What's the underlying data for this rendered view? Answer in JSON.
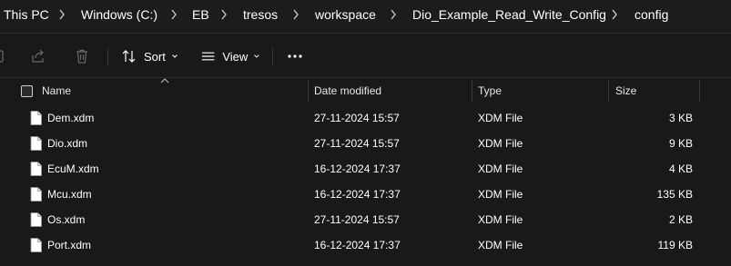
{
  "breadcrumb": {
    "items": [
      "This PC",
      "Windows (C:)",
      "EB",
      "tresos",
      "workspace",
      "Dio_Example_Read_Write_Config",
      "config"
    ]
  },
  "toolbar": {
    "sort_label": "Sort",
    "view_label": "View"
  },
  "columns": {
    "name": "Name",
    "date_modified": "Date modified",
    "type": "Type",
    "size": "Size"
  },
  "files": [
    {
      "name": "Dem.xdm",
      "date": "27-11-2024 15:57",
      "type": "XDM File",
      "size": "3 KB"
    },
    {
      "name": "Dio.xdm",
      "date": "27-11-2024 15:57",
      "type": "XDM File",
      "size": "9 KB"
    },
    {
      "name": "EcuM.xdm",
      "date": "16-12-2024 17:37",
      "type": "XDM File",
      "size": "4 KB"
    },
    {
      "name": "Mcu.xdm",
      "date": "16-12-2024 17:37",
      "type": "XDM File",
      "size": "135 KB"
    },
    {
      "name": "Os.xdm",
      "date": "27-11-2024 15:57",
      "type": "XDM File",
      "size": "2 KB"
    },
    {
      "name": "Port.xdm",
      "date": "16-12-2024 17:37",
      "type": "XDM File",
      "size": "119 KB"
    }
  ],
  "colors": {
    "background": "#191919",
    "text": "#ffffff"
  },
  "icons": {
    "breadcrumb_separator": "chevron-right-icon",
    "file": "document-icon",
    "sort": "sort-arrows-icon",
    "view": "view-lines-icon",
    "more": "more-options-icon"
  }
}
